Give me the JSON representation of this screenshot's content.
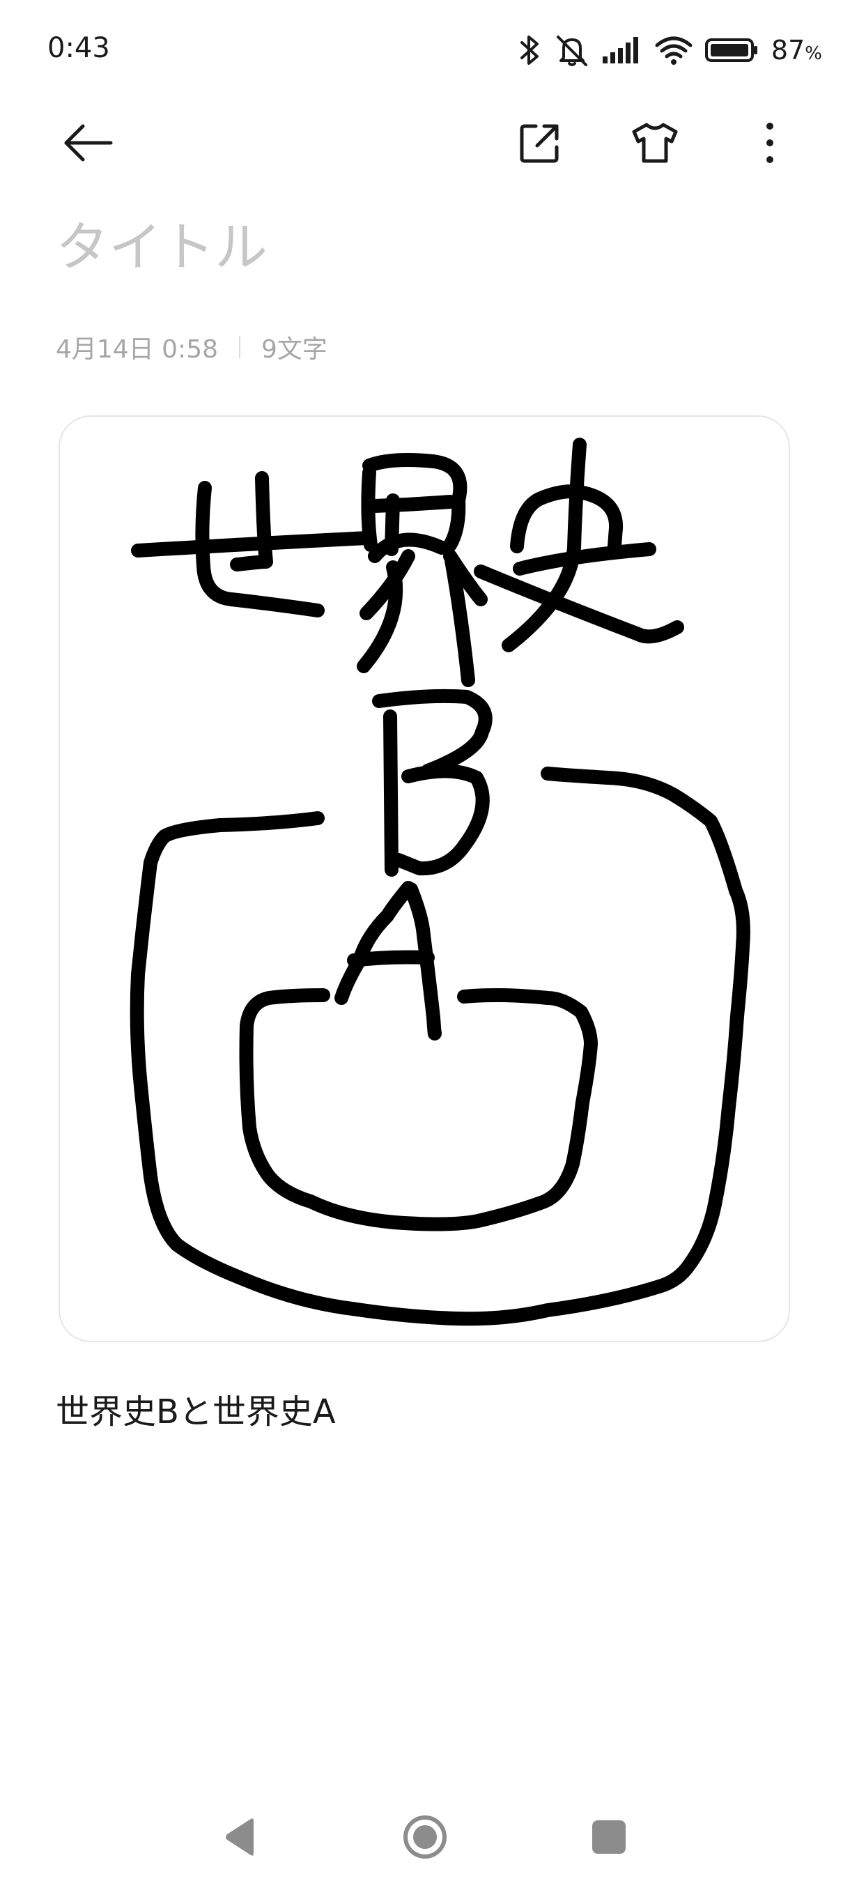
{
  "status_bar": {
    "time": "0:43",
    "battery_percent": "87",
    "battery_unit": "%",
    "icons": [
      "bluetooth-icon",
      "mute-icon",
      "signal-icon",
      "wifi-icon",
      "battery-icon"
    ]
  },
  "toolbar": {
    "icons": [
      "back-arrow-icon",
      "share-icon",
      "theme-shirt-icon",
      "more-vert-icon"
    ]
  },
  "note": {
    "title_placeholder": "タイトル",
    "date": "4月14日 0:58",
    "char_count": "9文字",
    "body": "世界史Bと世界史A"
  },
  "drawing": {
    "description_icon": "handwriting-sketch",
    "stroke_color": "#000000"
  },
  "nav_bar": {
    "icons": [
      "nav-back-icon",
      "nav-home-icon",
      "nav-recent-icon"
    ]
  },
  "colors": {
    "placeholder": "#c6c6c6",
    "meta_text": "#a6a6a6",
    "card_border": "#e6e6e6",
    "nav_icon": "#8c8c8c"
  }
}
